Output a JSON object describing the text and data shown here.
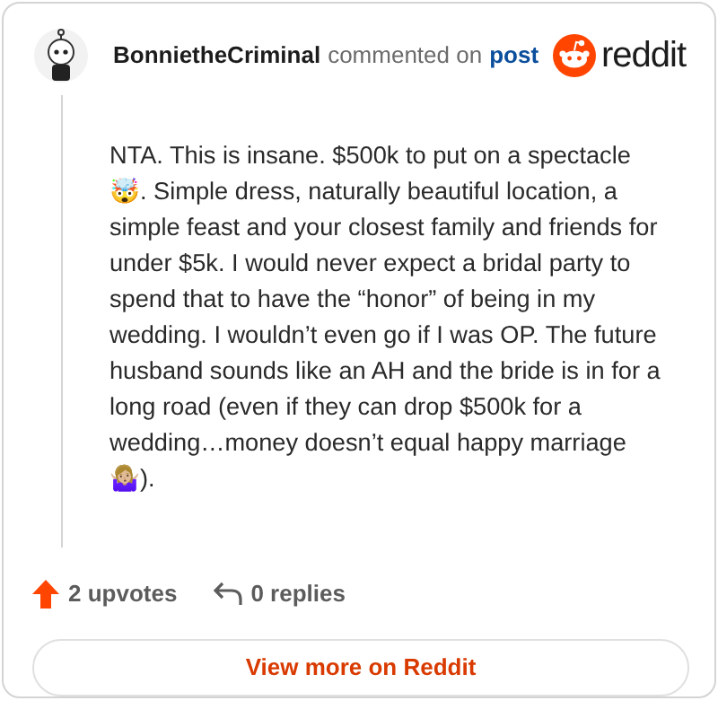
{
  "comment": {
    "author": "BonnietheCriminal",
    "action": "commented on",
    "link": "post",
    "body": "NTA. This is insane. $500k to put on a spectacle 🤯. Simple dress, naturally beautiful location, a simple feast and your closest family and friends for under $5k. I would never expect a bridal party to spend that to have the “honor” of being in my wedding. I wouldn’t even go if I was OP. The future husband sounds like an AH and the bride is in for a long road (even if they can drop $500k for a wedding…money doesn’t equal happy marriage 🤷🏼‍♀️)."
  },
  "brand": "reddit",
  "footer": {
    "upvotes": "2 upvotes",
    "replies": "0 replies"
  },
  "button": "View more on Reddit"
}
